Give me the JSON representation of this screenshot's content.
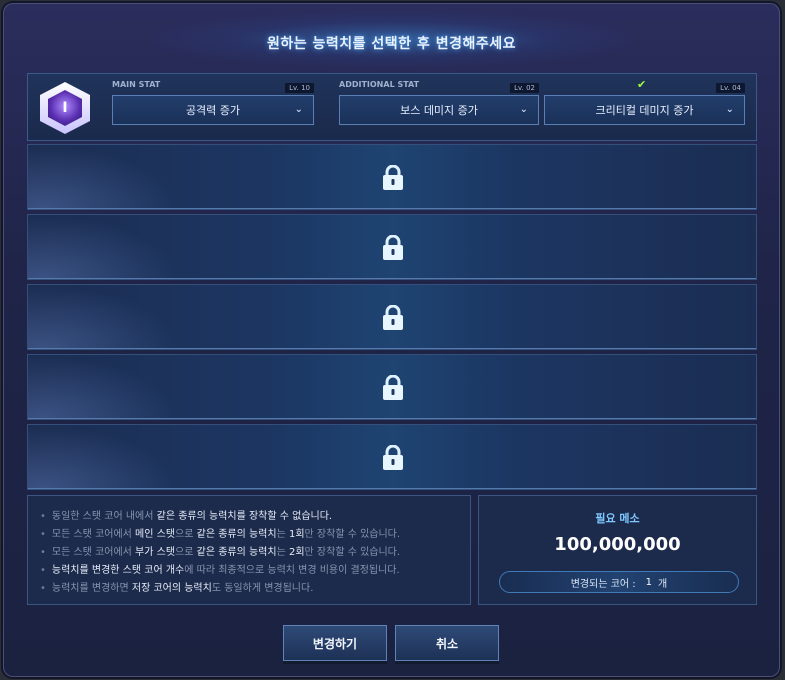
{
  "dialog": {
    "title": "원하는 능력치를 선택한 후 변경해주세요"
  },
  "stats": {
    "core_icon": "core-icon",
    "main": {
      "label": "MAIN STAT",
      "level": "Lv. 10",
      "value": "공격력 증가"
    },
    "additional": {
      "label": "ADDITIONAL STAT",
      "level": "Lv. 02",
      "value": "보스 데미지 증가"
    },
    "third": {
      "level": "Lv. 04",
      "value": "크리티컬 데미지 증가",
      "checked": true
    }
  },
  "locked_rows": [
    {
      "icon": "lock-icon"
    },
    {
      "icon": "lock-icon"
    },
    {
      "icon": "lock-icon"
    },
    {
      "icon": "lock-icon"
    },
    {
      "icon": "lock-icon"
    }
  ],
  "notes": {
    "n1": {
      "a": "동일한 스탯 코어 내에서 ",
      "b": "같은 종류의 능력치",
      "c": "를 장착할 수 없습니다."
    },
    "n2": {
      "a": "모든 스탯 코어에서 ",
      "b": "메인 스탯",
      "c": "으로 ",
      "d": "같은 종류의 능력치",
      "e": "는 ",
      "f": "1회",
      "g": "만 장착할 수 있습니다."
    },
    "n3": {
      "a": "모든 스탯 코어에서 ",
      "b": "부가 스탯",
      "c": "으로 ",
      "d": "같은 종류의 능력치",
      "e": "는 ",
      "f": "2회",
      "g": "만 장착할 수 있습니다."
    },
    "n4": {
      "a": "능력치를 변경한 스탯 코어 개수",
      "b": "에 따라 최종적으로 능력치 변경 비용이 결정됩니다."
    },
    "n5": {
      "a": "능력치를 변경하면 ",
      "b": "저장 코어의 능력치",
      "c": "도 동일하게 변경됩니다."
    }
  },
  "meso": {
    "title": "필요 메소",
    "value": "100,000,000",
    "cores_label": "변경되는 코어 :",
    "cores_count": "1",
    "cores_unit": "개"
  },
  "buttons": {
    "confirm": "변경하기",
    "cancel": "취소"
  },
  "colors": {
    "accent": "#7ec8ff",
    "check": "#9bff3b",
    "panel": "#1c2a4b"
  }
}
